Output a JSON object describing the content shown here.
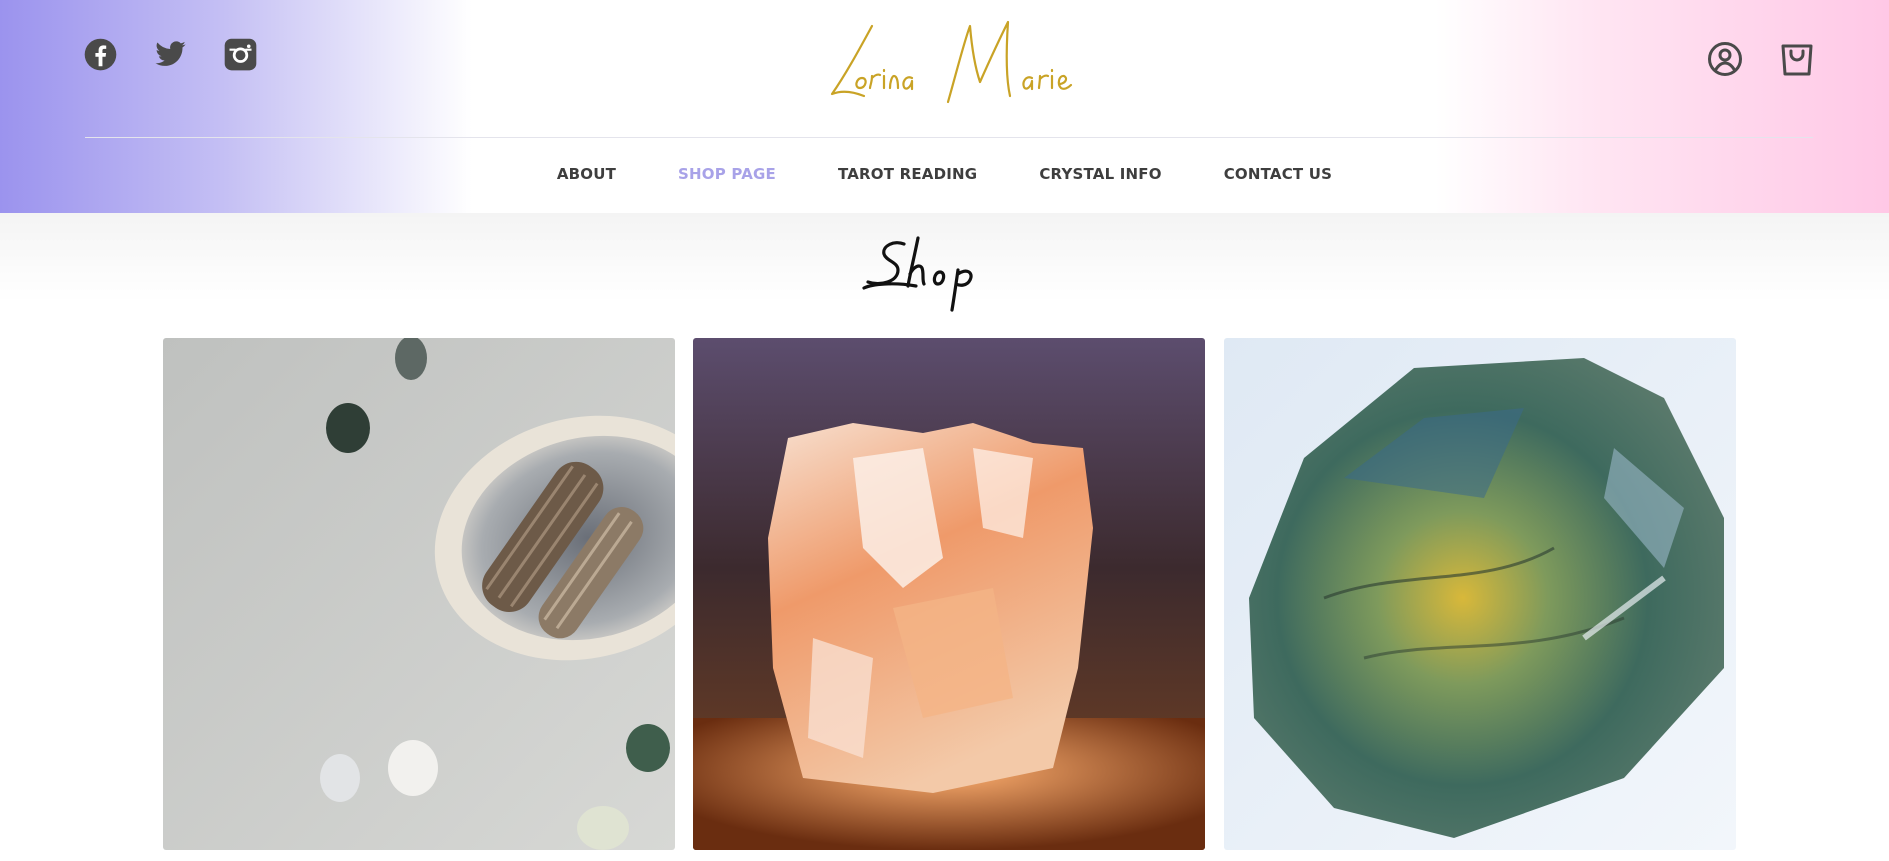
{
  "brand": {
    "logo_text": "Lorina Marie",
    "logo_color": "#c9a326"
  },
  "social": [
    {
      "icon": "facebook-icon"
    },
    {
      "icon": "twitter-icon"
    },
    {
      "icon": "instagram-icon"
    }
  ],
  "header_actions": {
    "account_icon": "user-circle-icon",
    "cart_icon": "shopping-bag-icon"
  },
  "nav": {
    "items": [
      {
        "label": "ABOUT",
        "active": false
      },
      {
        "label": "SHOP PAGE",
        "active": true
      },
      {
        "label": "TAROT READING",
        "active": false
      },
      {
        "label": "CRYSTAL INFO",
        "active": false
      },
      {
        "label": "CONTACT US",
        "active": false
      }
    ],
    "active_color": "#a8a2e8",
    "text_color": "#3e3e3e"
  },
  "page": {
    "title": "Shop"
  },
  "colors": {
    "gradient_left": "#9b93ee",
    "gradient_right": "#ffc8e6"
  }
}
